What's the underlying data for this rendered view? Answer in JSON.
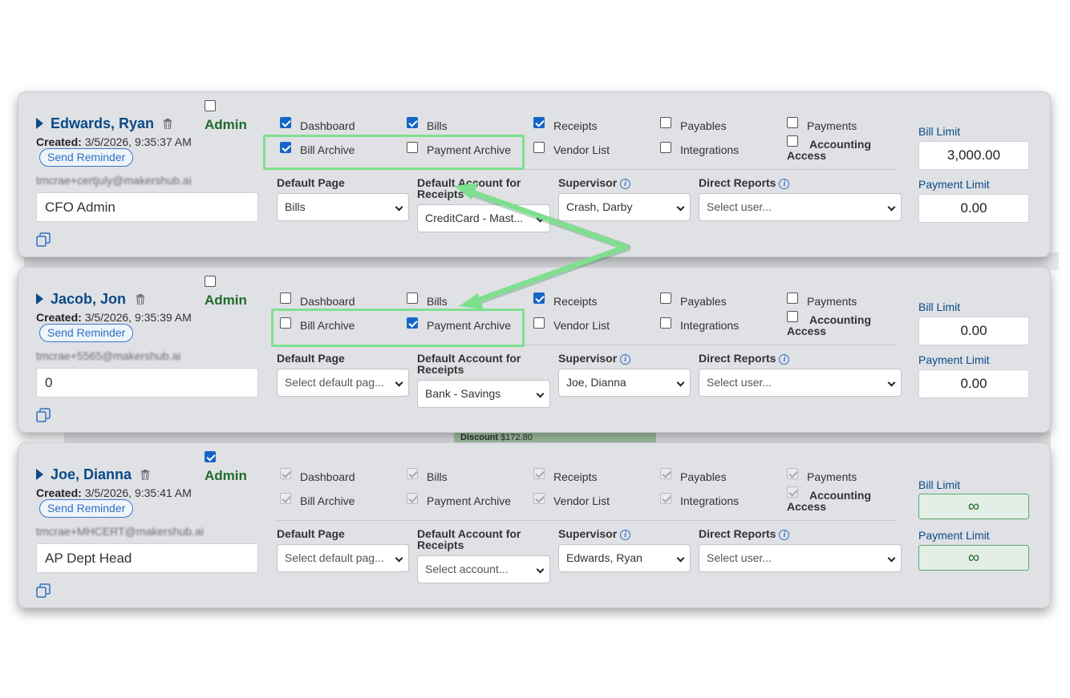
{
  "users": [
    {
      "name": "Edwards, Ryan",
      "admin": false,
      "admin_label": "Admin",
      "created_label": "Created:",
      "created": "3/5/2026, 9:35:37 AM",
      "send_reminder": "Send Reminder",
      "email": "tmcrae+certjuly@makershub.ai",
      "title": "CFO Admin",
      "perms": {
        "dashboard": true,
        "bills": true,
        "receipts": true,
        "payables": false,
        "payments": false,
        "bill_archive": true,
        "payment_archive": false,
        "vendor_list": false,
        "integrations": false,
        "accounting_access": false
      },
      "default_page_label": "Default Page",
      "default_page": "Bills",
      "default_account_label": "Default Account for Receipts",
      "default_account": "CreditCard - Mast...",
      "supervisor_label": "Supervisor",
      "supervisor": "Crash, Darby",
      "direct_reports_label": "Direct Reports",
      "direct_reports": "Select user...",
      "bill_limit_label": "Bill Limit",
      "bill_limit": "3,000.00",
      "payment_limit_label": "Payment Limit",
      "payment_limit": "0.00"
    },
    {
      "name": "Jacob, Jon",
      "admin": false,
      "admin_label": "Admin",
      "created_label": "Created:",
      "created": "3/5/2026, 9:35:39 AM",
      "send_reminder": "Send Reminder",
      "email": "tmcrae+5565@makershub.ai",
      "title": "0",
      "perms": {
        "dashboard": false,
        "bills": false,
        "receipts": true,
        "payables": false,
        "payments": false,
        "bill_archive": false,
        "payment_archive": true,
        "vendor_list": false,
        "integrations": false,
        "accounting_access": false
      },
      "default_page_label": "Default Page",
      "default_page": "Select default pag...",
      "default_account_label": "Default Account for Receipts",
      "default_account": "Bank - Savings",
      "supervisor_label": "Supervisor",
      "supervisor": "Joe, Dianna",
      "direct_reports_label": "Direct Reports",
      "direct_reports": "Select user...",
      "bill_limit_label": "Bill Limit",
      "bill_limit": "0.00",
      "payment_limit_label": "Payment Limit",
      "payment_limit": "0.00"
    },
    {
      "name": "Joe, Dianna",
      "admin": true,
      "admin_label": "Admin",
      "created_label": "Created:",
      "created": "3/5/2026, 9:35:41 AM",
      "send_reminder": "Send Reminder",
      "email": "tmcrae+MHCERT@makershub.ai",
      "title": "AP Dept Head",
      "perms": {
        "dashboard": true,
        "bills": true,
        "receipts": true,
        "payables": true,
        "payments": true,
        "bill_archive": true,
        "payment_archive": true,
        "vendor_list": true,
        "integrations": true,
        "accounting_access": true
      },
      "default_page_label": "Default Page",
      "default_page": "Select default pag...",
      "default_account_label": "Default Account for Receipts",
      "default_account": "Select account...",
      "supervisor_label": "Supervisor",
      "supervisor": "Edwards, Ryan",
      "direct_reports_label": "Direct Reports",
      "direct_reports": "Select user...",
      "bill_limit_label": "Bill Limit",
      "bill_limit": "∞",
      "payment_limit_label": "Payment Limit",
      "payment_limit": "∞"
    }
  ],
  "perm_labels": {
    "dashboard": "Dashboard",
    "bills": "Bills",
    "receipts": "Receipts",
    "payables": "Payables",
    "payments": "Payments",
    "bill_archive": "Bill Archive",
    "payment_archive": "Payment Archive",
    "vendor_list": "Vendor List",
    "integrations": "Integrations",
    "accounting_access": "Accounting Access"
  },
  "background_text": {
    "discount_label": "Discount",
    "discount_value": "$172.80"
  },
  "colors": {
    "accent": "#0b4a86",
    "admin": "#1f6b2c",
    "highlight": "#7ee08e",
    "checkbox": "#1565c8"
  }
}
